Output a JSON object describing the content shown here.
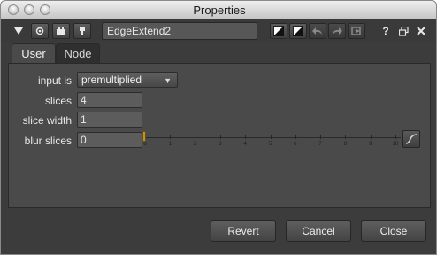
{
  "window": {
    "title": "Properties"
  },
  "toolbar": {
    "node_name": "EdgeExtend2",
    "help_label": "?"
  },
  "tabs": [
    {
      "label": "User"
    },
    {
      "label": "Node"
    }
  ],
  "knobs": {
    "input_is": {
      "label": "input is",
      "value": "premultiplied"
    },
    "slices": {
      "label": "slices",
      "value": "4"
    },
    "slice_width": {
      "label": "slice width",
      "value": "1"
    },
    "blur_slices": {
      "label": "blur slices",
      "value": "0",
      "slider_ticks": [
        "0",
        "1",
        "2",
        "3",
        "4",
        "5",
        "6",
        "7",
        "8",
        "9",
        "10"
      ]
    }
  },
  "buttons": {
    "revert": "Revert",
    "cancel": "Cancel",
    "close": "Close"
  },
  "colors": {
    "accent_handle": "#b9922a",
    "panel": "#4a4a4a",
    "background": "#3c3c3c"
  }
}
